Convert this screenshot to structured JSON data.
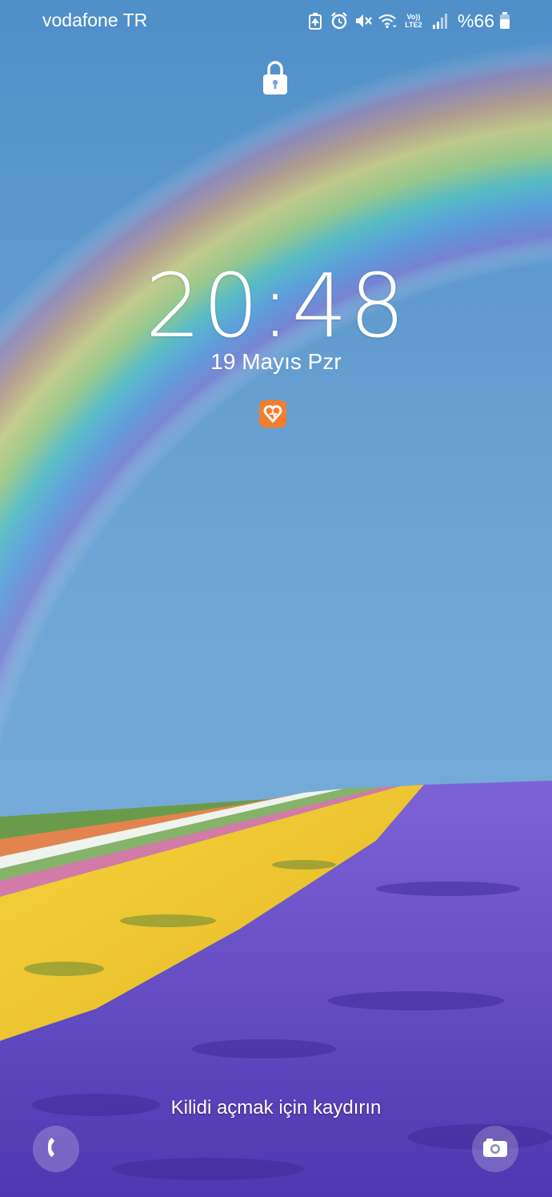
{
  "status_bar": {
    "carrier": "vodafone TR",
    "icons": [
      "battery-saver-icon",
      "alarm-icon",
      "mute-icon",
      "wifi-icon",
      "volte-lte2-icon",
      "signal-icon"
    ],
    "volte_label": "Vo))",
    "lte_label": "LTE2",
    "battery_percent": "%66"
  },
  "lock_screen": {
    "time": "20:48",
    "date": "19 Mayıs Pzr",
    "notification_icon": "health-app-icon",
    "unlock_hint": "Kilidi açmak için kaydırın"
  },
  "shortcuts": {
    "left": "phone-icon",
    "right": "camera-icon"
  },
  "colors": {
    "notification_accent": "#f47d2f",
    "sky": "#6fa6d4",
    "lavender": "#6a4fc4"
  }
}
